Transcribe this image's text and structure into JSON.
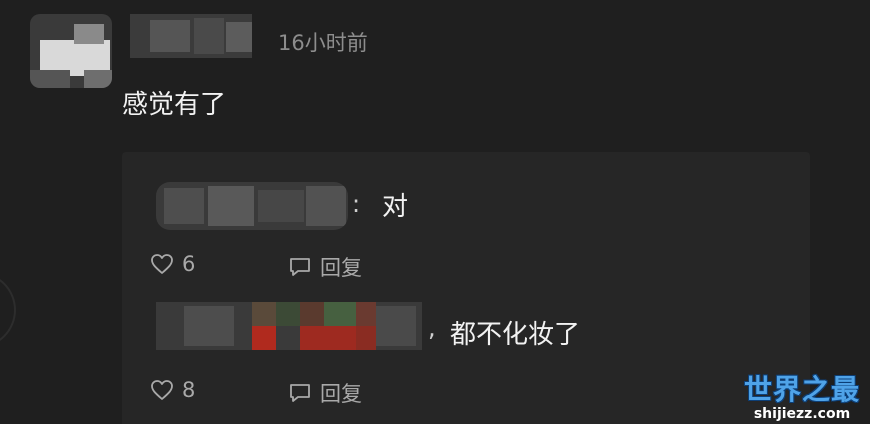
{
  "comment": {
    "timestamp": "16小时前",
    "text": "感觉有了"
  },
  "replies": [
    {
      "separator": ":",
      "text": "对",
      "likes": "6",
      "reply_label": "回复"
    },
    {
      "separator": ",",
      "text": "都不化妆了",
      "likes": "8",
      "reply_label": "回复"
    }
  ],
  "watermark": {
    "title": "世界之最",
    "url": "shijiezz.com"
  },
  "icons": [
    "heart-icon",
    "chat-bubble-icon"
  ],
  "colors": {
    "background": "#1f1f1f",
    "panel": "#262626",
    "muted_text": "#a9a9a9",
    "watermark_blue": "#4fa3e8"
  }
}
